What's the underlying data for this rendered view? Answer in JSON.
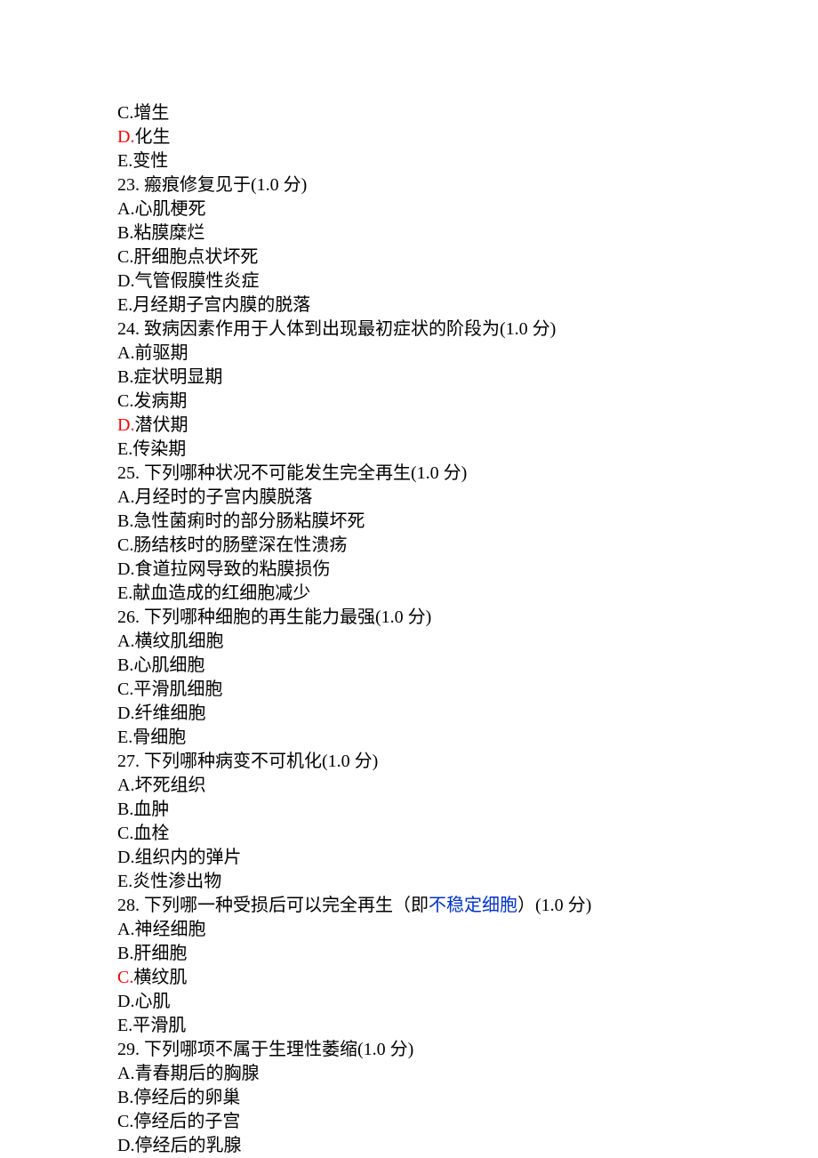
{
  "lines": [
    {
      "prefixRed": "",
      "text": "C.增生",
      "blue": "",
      "suffix": ""
    },
    {
      "prefixRed": "D.",
      "text": "化生",
      "blue": "",
      "suffix": ""
    },
    {
      "prefixRed": "",
      "text": "E.变性",
      "blue": "",
      "suffix": ""
    },
    {
      "prefixRed": "",
      "text": "23.  瘢痕修复见于(1.0 分)",
      "blue": "",
      "suffix": ""
    },
    {
      "prefixRed": "",
      "text": "A.心肌梗死",
      "blue": "",
      "suffix": ""
    },
    {
      "prefixRed": "",
      "text": "B.粘膜糜烂",
      "blue": "",
      "suffix": ""
    },
    {
      "prefixRed": "",
      "text": "C.肝细胞点状坏死",
      "blue": "",
      "suffix": ""
    },
    {
      "prefixRed": "",
      "text": "D.气管假膜性炎症",
      "blue": "",
      "suffix": ""
    },
    {
      "prefixRed": "",
      "text": "E.月经期子宫内膜的脱落",
      "blue": "",
      "suffix": ""
    },
    {
      "prefixRed": "",
      "text": "24.  致病因素作用于人体到出现最初症状的阶段为(1.0 分)",
      "blue": "",
      "suffix": ""
    },
    {
      "prefixRed": "",
      "text": "A.前驱期",
      "blue": "",
      "suffix": ""
    },
    {
      "prefixRed": "",
      "text": "B.症状明显期",
      "blue": "",
      "suffix": ""
    },
    {
      "prefixRed": "",
      "text": "C.发病期",
      "blue": "",
      "suffix": ""
    },
    {
      "prefixRed": "D.",
      "text": "潜伏期",
      "blue": "",
      "suffix": ""
    },
    {
      "prefixRed": "",
      "text": "E.传染期",
      "blue": "",
      "suffix": ""
    },
    {
      "prefixRed": "",
      "text": "25.  下列哪种状况不可能发生完全再生(1.0 分)",
      "blue": "",
      "suffix": ""
    },
    {
      "prefixRed": "",
      "text": "A.月经时的子宫内膜脱落",
      "blue": "",
      "suffix": ""
    },
    {
      "prefixRed": "",
      "text": "B.急性菌痢时的部分肠粘膜坏死",
      "blue": "",
      "suffix": ""
    },
    {
      "prefixRed": "",
      "text": "C.肠结核时的肠壁深在性溃疡",
      "blue": "",
      "suffix": ""
    },
    {
      "prefixRed": "",
      "text": "D.食道拉网导致的粘膜损伤",
      "blue": "",
      "suffix": ""
    },
    {
      "prefixRed": "",
      "text": "E.献血造成的红细胞减少",
      "blue": "",
      "suffix": ""
    },
    {
      "prefixRed": "",
      "text": "26.  下列哪种细胞的再生能力最强(1.0 分)",
      "blue": "",
      "suffix": ""
    },
    {
      "prefixRed": "",
      "text": "A.横纹肌细胞",
      "blue": "",
      "suffix": ""
    },
    {
      "prefixRed": "",
      "text": "B.心肌细胞",
      "blue": "",
      "suffix": ""
    },
    {
      "prefixRed": "",
      "text": "C.平滑肌细胞",
      "blue": "",
      "suffix": ""
    },
    {
      "prefixRed": "",
      "text": "D.纤维细胞",
      "blue": "",
      "suffix": ""
    },
    {
      "prefixRed": "",
      "text": "E.骨细胞",
      "blue": "",
      "suffix": ""
    },
    {
      "prefixRed": "",
      "text": "27.  下列哪种病变不可机化(1.0 分)",
      "blue": "",
      "suffix": ""
    },
    {
      "prefixRed": "",
      "text": "A.坏死组织",
      "blue": "",
      "suffix": ""
    },
    {
      "prefixRed": "",
      "text": "B.血肿",
      "blue": "",
      "suffix": ""
    },
    {
      "prefixRed": "",
      "text": "C.血栓",
      "blue": "",
      "suffix": ""
    },
    {
      "prefixRed": "",
      "text": "D.组织内的弹片",
      "blue": "",
      "suffix": ""
    },
    {
      "prefixRed": "",
      "text": "E.炎性渗出物",
      "blue": "",
      "suffix": ""
    },
    {
      "prefixRed": "",
      "text": "28.  下列哪一种受损后可以完全再生（即",
      "blue": "不稳定细胞",
      "suffix": "）(1.0 分)"
    },
    {
      "prefixRed": "",
      "text": "A.神经细胞",
      "blue": "",
      "suffix": ""
    },
    {
      "prefixRed": "",
      "text": "B.肝细胞",
      "blue": "",
      "suffix": ""
    },
    {
      "prefixRed": "C.",
      "text": "横纹肌",
      "blue": "",
      "suffix": ""
    },
    {
      "prefixRed": "",
      "text": "D.心肌",
      "blue": "",
      "suffix": ""
    },
    {
      "prefixRed": "",
      "text": "E.平滑肌",
      "blue": "",
      "suffix": ""
    },
    {
      "prefixRed": "",
      "text": "29.  下列哪项不属于生理性萎缩(1.0 分)",
      "blue": "",
      "suffix": ""
    },
    {
      "prefixRed": "",
      "text": "A.青春期后的胸腺",
      "blue": "",
      "suffix": ""
    },
    {
      "prefixRed": "",
      "text": "B.停经后的卵巢",
      "blue": "",
      "suffix": ""
    },
    {
      "prefixRed": "",
      "text": "C.停经后的子宫",
      "blue": "",
      "suffix": ""
    },
    {
      "prefixRed": "",
      "text": "D.停经后的乳腺",
      "blue": "",
      "suffix": ""
    }
  ]
}
